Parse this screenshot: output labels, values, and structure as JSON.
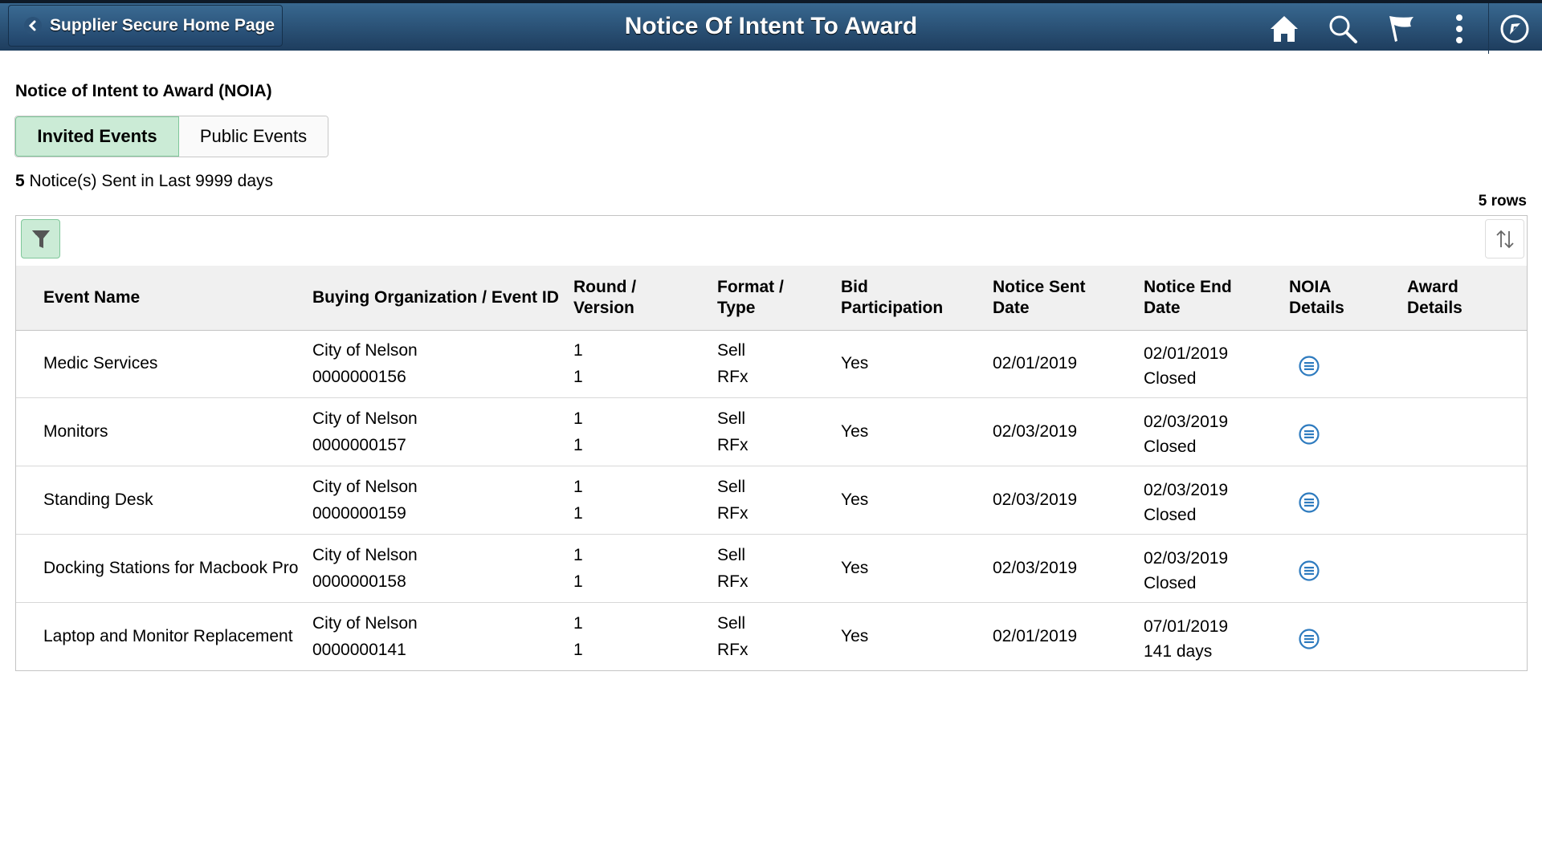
{
  "banner": {
    "back_label": "Supplier Secure Home Page",
    "title": "Notice Of Intent To Award",
    "icons": [
      "home-icon",
      "search-icon",
      "flag-icon",
      "more-vertical-icon",
      "navbar-compass-icon"
    ]
  },
  "section": {
    "title": "Notice of Intent to Award (NOIA)"
  },
  "tabs": [
    {
      "label": "Invited Events",
      "active": true
    },
    {
      "label": "Public Events",
      "active": false
    }
  ],
  "notice_count": {
    "count": "5",
    "text": " Notice(s) Sent in Last 9999 days"
  },
  "grid": {
    "row_count_label": "5 rows",
    "columns": [
      "Event Name",
      "Buying Organization / Event ID",
      "Round / Version",
      "Format / Type",
      "Bid Participation",
      "Notice Sent Date",
      "Notice End Date",
      "NOIA Details",
      "Award Details"
    ],
    "rows": [
      {
        "event_name": "Medic Services",
        "org": "City of Nelson",
        "event_id": "0000000156",
        "round": "1",
        "version": "1",
        "format": "Sell",
        "type": "RFx",
        "bid": "Yes",
        "sent": "02/01/2019",
        "end_date": "02/01/2019",
        "end_status": "Closed"
      },
      {
        "event_name": "Monitors",
        "org": "City of Nelson",
        "event_id": "0000000157",
        "round": "1",
        "version": "1",
        "format": "Sell",
        "type": "RFx",
        "bid": "Yes",
        "sent": "02/03/2019",
        "end_date": "02/03/2019",
        "end_status": "Closed"
      },
      {
        "event_name": "Standing Desk",
        "org": "City of Nelson",
        "event_id": "0000000159",
        "round": "1",
        "version": "1",
        "format": "Sell",
        "type": "RFx",
        "bid": "Yes",
        "sent": "02/03/2019",
        "end_date": "02/03/2019",
        "end_status": "Closed"
      },
      {
        "event_name": "Docking Stations for Macbook Pro",
        "org": "City of Nelson",
        "event_id": "0000000158",
        "round": "1",
        "version": "1",
        "format": "Sell",
        "type": "RFx",
        "bid": "Yes",
        "sent": "02/03/2019",
        "end_date": "02/03/2019",
        "end_status": "Closed"
      },
      {
        "event_name": "Laptop and Monitor Replacement",
        "org": "City of Nelson",
        "event_id": "0000000141",
        "round": "1",
        "version": "1",
        "format": "Sell",
        "type": "RFx",
        "bid": "Yes",
        "sent": "02/01/2019",
        "end_date": "07/01/2019",
        "end_status": "141 days"
      }
    ]
  },
  "colors": {
    "banner_top": "#386890",
    "banner_bottom": "#1e3d5e",
    "active_tab": "#cbebd6",
    "active_border": "#7fc79a",
    "header_row": "#f0f0f0",
    "noia_icon": "#2e7bbf"
  }
}
